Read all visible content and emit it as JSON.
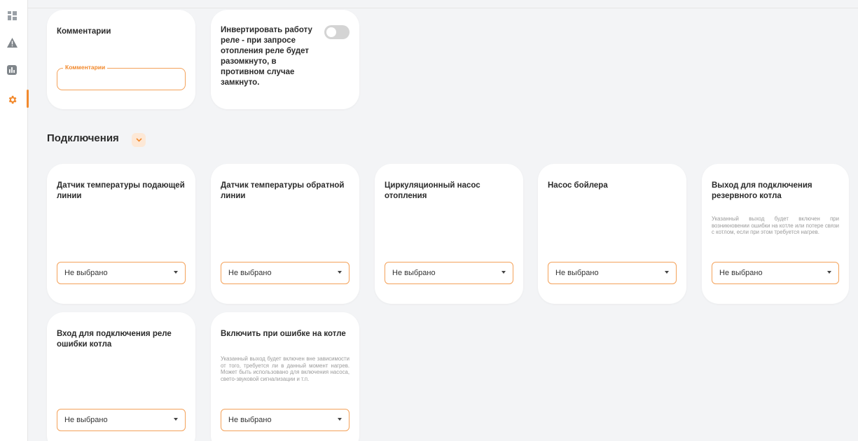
{
  "sidebar": {
    "items": [
      {
        "icon": "dashboard-icon"
      },
      {
        "icon": "warning-icon"
      },
      {
        "icon": "chart-icon"
      },
      {
        "icon": "gear-icon",
        "active": true
      }
    ]
  },
  "colors": {
    "accent": "#f28a2e",
    "border": "#f4a25a",
    "background": "#f3f4f6"
  },
  "top_cards": {
    "comments": {
      "title": "Комментарии",
      "field_label": "Комментарии",
      "field_value": ""
    },
    "invert": {
      "title": "Инвертировать работу реле - при запросе отопления реле будет разомкнуто, в противном случае замкнуто.",
      "toggle_on": false
    }
  },
  "section": {
    "title": "Подключения"
  },
  "connections": [
    {
      "title": "Датчик температуры подающей линии",
      "desc": "",
      "value": "Не выбрано"
    },
    {
      "title": "Датчик температуры обратной линии",
      "desc": "",
      "value": "Не выбрано"
    },
    {
      "title": "Циркуляционный насос отопления",
      "desc": "",
      "value": "Не выбрано"
    },
    {
      "title": "Насос бойлера",
      "desc": "",
      "value": "Не выбрано"
    },
    {
      "title": "Выход для подключения резервного котла",
      "desc": "Указанный выход будет включен при возникновении ошибки на котле или потере связи с котлом, если при этом требуется нагрев.",
      "value": "Не выбрано"
    },
    {
      "title": "Вход для подключения реле ошибки котла",
      "desc": "",
      "value": "Не выбрано"
    },
    {
      "title": "Включить при ошибке на котле",
      "desc": "Указанный выход будет включен вне зависимости от того, требуется ли в данный момент нагрев. Может быть использовано для включения насоса, свето-звуковой сигнализации и т.п.",
      "value": "Не выбрано"
    }
  ]
}
